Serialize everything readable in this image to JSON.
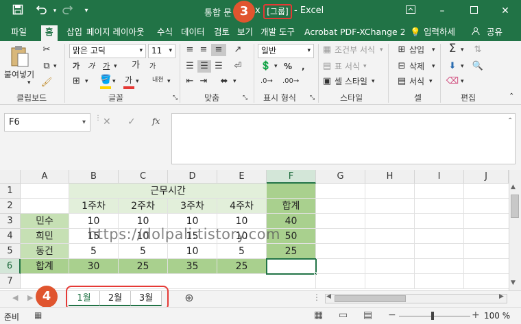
{
  "title_bar": {
    "doc_name": "통합 문",
    "title_suffix": "x",
    "group_marker": "[그룹]",
    "app_name": "- Excel",
    "step3": "3",
    "save_icon": "save-icon",
    "undo_icon": "undo-icon",
    "redo_icon": "redo-icon"
  },
  "menu": {
    "tabs": [
      "파일",
      "홈",
      "삽입",
      "페이지 레이아웃",
      "수식",
      "데이터",
      "검토",
      "보기",
      "개발 도구",
      "Acrobat",
      "PDF-XChange 2C"
    ],
    "tell_me": "입력하세",
    "share": "공유"
  },
  "ribbon": {
    "clipboard": {
      "paste": "붙여넣기",
      "label": "클립보드"
    },
    "font": {
      "name": "맑은 고딕",
      "size": "11",
      "label": "글꼴",
      "bold": "가",
      "italic": "가",
      "underline": "가",
      "grow": "가",
      "shrink": "가",
      "phonetic": "내천",
      "font_color_char": "가"
    },
    "alignment": {
      "label": "맞춤"
    },
    "number": {
      "format": "일반",
      "label": "표시 형식",
      "percent": "%",
      "comma": ","
    },
    "styles": {
      "conditional": "조건부 서식",
      "table": "표 서식",
      "cell_styles": "셀 스타일",
      "label": "스타일"
    },
    "cells": {
      "insert": "삽입",
      "delete": "삭제",
      "format": "서식",
      "label": "셀"
    },
    "editing": {
      "label": "편집"
    },
    "accent": "#217346"
  },
  "formula_bar": {
    "name_box": "F6",
    "formula": "",
    "fx": "fx"
  },
  "sheet": {
    "columns": [
      "A",
      "B",
      "C",
      "D",
      "E",
      "F",
      "G",
      "H",
      "I",
      "J"
    ],
    "rows": [
      "1",
      "2",
      "3",
      "4",
      "5",
      "6",
      "7"
    ],
    "header_work_hours": "근무시간",
    "week_labels": [
      "1주차",
      "2주차",
      "3주차",
      "4주차"
    ],
    "total_label": "합계",
    "data": [
      {
        "name": "민수",
        "values": [
          "10",
          "10",
          "10",
          "10"
        ],
        "sum": "40"
      },
      {
        "name": "희민",
        "values": [
          "15",
          "10",
          "15",
          "10"
        ],
        "sum": "50"
      },
      {
        "name": "동건",
        "values": [
          "5",
          "5",
          "10",
          "5"
        ],
        "sum": "25"
      }
    ],
    "totals_row": {
      "name": "합계",
      "values": [
        "30",
        "25",
        "35",
        "25"
      ],
      "sum": ""
    },
    "header_fill": "#e2efda",
    "name_fill": "#c6e0b4",
    "total_fill": "#a9d08e",
    "selected_cell": "F6"
  },
  "watermark": "https://dolpali.tistory.com",
  "tabs": {
    "step4": "4",
    "sheets": [
      "1월",
      "2월",
      "3월"
    ],
    "add_icon": "plus-circle-icon"
  },
  "status": {
    "ready": "준비",
    "zoom": "100 %"
  }
}
